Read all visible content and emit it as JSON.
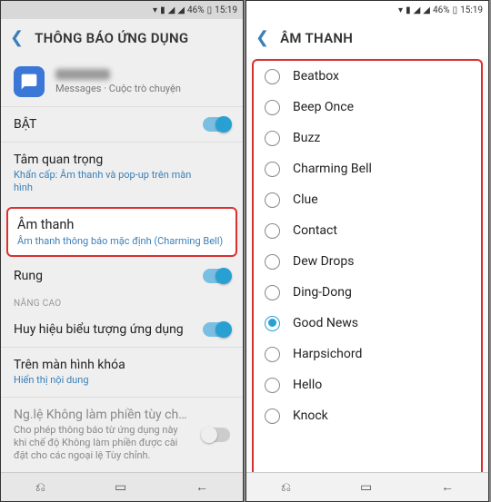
{
  "status": {
    "battery": "46%",
    "time": "15:19"
  },
  "left": {
    "title": "THÔNG BÁO ỨNG DỤNG",
    "app_sub": "Messages · Cuộc trò chuyện",
    "on_label": "BẬT",
    "importance_label": "Tâm quan trọng",
    "importance_sub": "Khẩn cấp: Âm thanh và pop-up trên màn hình",
    "sound_label": "Âm thanh",
    "sound_sub": "Âm thanh thông báo mặc định (Charming Bell)",
    "vibrate_label": "Rung",
    "advanced_label": "NÂNG CAO",
    "badge_label": "Huy hiệu biểu tượng ứng dụng",
    "lockscreen_label": "Trên màn hình khóa",
    "lockscreen_sub": "Hiển thị nội dung",
    "dnd_label": "Ng.lệ Không làm phiền tùy ch…",
    "dnd_sub": "Cho phép thông báo từ ứng dụng này khi chế độ Không làm phiền được cài đặt cho các ngoại lệ Tùy chỉnh."
  },
  "right": {
    "title": "ÂM THANH",
    "sounds": [
      "Beatbox",
      "Beep Once",
      "Buzz",
      "Charming Bell",
      "Clue",
      "Contact",
      "Dew Drops",
      "Ding-Dong",
      "Good News",
      "Harpsichord",
      "Hello",
      "Knock"
    ],
    "selected": "Good News"
  }
}
